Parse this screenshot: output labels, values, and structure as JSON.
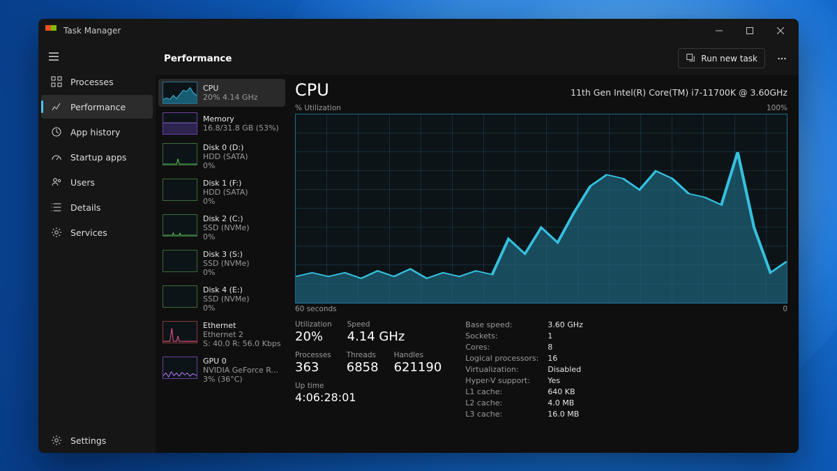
{
  "window": {
    "title": "Task Manager"
  },
  "nav": {
    "items": [
      {
        "label": "Processes"
      },
      {
        "label": "Performance"
      },
      {
        "label": "App history"
      },
      {
        "label": "Startup apps"
      },
      {
        "label": "Users"
      },
      {
        "label": "Details"
      },
      {
        "label": "Services"
      }
    ],
    "settings_label": "Settings"
  },
  "toolbar": {
    "title": "Performance",
    "run_new_task": "Run new task"
  },
  "resources": [
    {
      "name": "CPU",
      "line2": "20% 4.14 GHz",
      "line3": ""
    },
    {
      "name": "Memory",
      "line2": "16.8/31.8 GB (53%)",
      "line3": ""
    },
    {
      "name": "Disk 0 (D:)",
      "line2": "HDD (SATA)",
      "line3": "0%"
    },
    {
      "name": "Disk 1 (F:)",
      "line2": "HDD (SATA)",
      "line3": "0%"
    },
    {
      "name": "Disk 2 (C:)",
      "line2": "SSD (NVMe)",
      "line3": "0%"
    },
    {
      "name": "Disk 3 (S:)",
      "line2": "SSD (NVMe)",
      "line3": "0%"
    },
    {
      "name": "Disk 4 (E:)",
      "line2": "SSD (NVMe)",
      "line3": "0%"
    },
    {
      "name": "Ethernet",
      "line2": "Ethernet 2",
      "line3": "S: 40.0 R: 56.0 Kbps"
    },
    {
      "name": "GPU 0",
      "line2": "NVIDIA GeForce R...",
      "line3": "3% (36°C)"
    }
  ],
  "detail": {
    "title": "CPU",
    "subtitle": "11th Gen Intel(R) Core(TM) i7-11700K @ 3.60GHz",
    "y_label": "% Utilization",
    "y_max": "100%",
    "x_left": "60 seconds",
    "x_right": "0",
    "stats": {
      "utilization_label": "Utilization",
      "utilization": "20%",
      "speed_label": "Speed",
      "speed": "4.14 GHz",
      "processes_label": "Processes",
      "processes": "363",
      "threads_label": "Threads",
      "threads": "6858",
      "handles_label": "Handles",
      "handles": "621190",
      "uptime_label": "Up time",
      "uptime": "4:06:28:01"
    },
    "kv": [
      {
        "k": "Base speed:",
        "v": "3.60 GHz"
      },
      {
        "k": "Sockets:",
        "v": "1"
      },
      {
        "k": "Cores:",
        "v": "8"
      },
      {
        "k": "Logical processors:",
        "v": "16"
      },
      {
        "k": "Virtualization:",
        "v": "Disabled"
      },
      {
        "k": "Hyper-V support:",
        "v": "Yes"
      },
      {
        "k": "L1 cache:",
        "v": "640 KB"
      },
      {
        "k": "L2 cache:",
        "v": "4.0 MB"
      },
      {
        "k": "L3 cache:",
        "v": "16.0 MB"
      }
    ]
  },
  "chart_data": {
    "type": "area",
    "title": "CPU % Utilization",
    "xlabel": "seconds ago",
    "ylabel": "% Utilization",
    "ylim": [
      0,
      100
    ],
    "xlim": [
      60,
      0
    ],
    "x": [
      60,
      58,
      56,
      54,
      52,
      50,
      48,
      46,
      44,
      42,
      40,
      38,
      36,
      34,
      32,
      30,
      28,
      26,
      24,
      22,
      20,
      18,
      16,
      14,
      12,
      10,
      8,
      6,
      4,
      2,
      0
    ],
    "values": [
      14,
      16,
      14,
      16,
      13,
      17,
      14,
      18,
      13,
      16,
      14,
      17,
      15,
      34,
      26,
      40,
      32,
      48,
      62,
      68,
      66,
      60,
      70,
      66,
      58,
      56,
      52,
      80,
      40,
      16,
      22
    ]
  }
}
